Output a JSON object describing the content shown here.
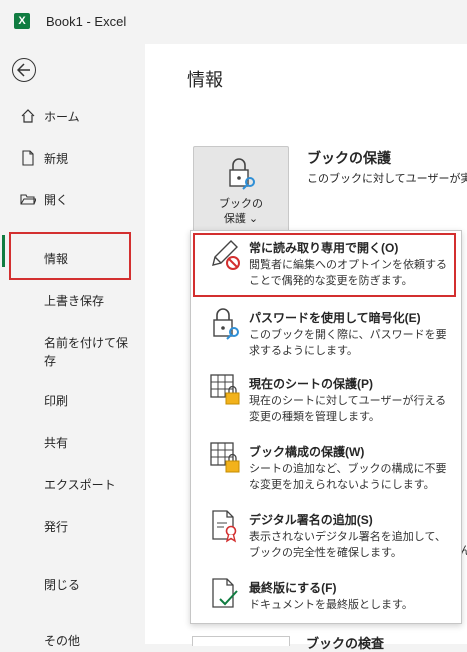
{
  "window": {
    "app_icon": "X",
    "title": "Book1  -  Excel"
  },
  "nav": {
    "back_icon": "back-arrow-icon",
    "items": [
      {
        "label": "ホーム",
        "icon": "home-icon"
      },
      {
        "label": "新規",
        "icon": "new-document-icon"
      },
      {
        "label": "開く",
        "icon": "open-folder-icon"
      },
      {
        "label": "情報"
      },
      {
        "label": "上書き保存"
      },
      {
        "label": "名前を付けて保存"
      },
      {
        "label": "印刷"
      },
      {
        "label": "共有"
      },
      {
        "label": "エクスポート"
      },
      {
        "label": "発行"
      },
      {
        "label": "閉じる"
      },
      {
        "label": "その他"
      }
    ],
    "active": "情報"
  },
  "main": {
    "title": "情報",
    "protect_button": {
      "line1": "ブックの",
      "line2": "保護 ⌄"
    },
    "section_title": "ブックの保護",
    "section_desc": "このブックに対してユーザーが実行",
    "peek_right": [
      "ん"
    ],
    "bottom_text": "ブックの検査"
  },
  "protect_menu": {
    "items": [
      {
        "title": "常に読み取り専用で開く(O)",
        "desc": "閲覧者に編集へのオプトインを依頼することで偶発的な変更を防ぎます。",
        "icon": "pencil-no-icon"
      },
      {
        "title": "パスワードを使用して暗号化(E)",
        "desc": "このブックを開く際に、パスワードを要求するようにします。",
        "icon": "lock-key-icon"
      },
      {
        "title": "現在のシートの保護(P)",
        "desc": "現在のシートに対してユーザーが行える変更の種類を管理します。",
        "icon": "sheet-lock-icon"
      },
      {
        "title": "ブック構成の保護(W)",
        "desc": "シートの追加など、ブックの構成に不要な変更を加えられないようにします。",
        "icon": "workbook-lock-icon"
      },
      {
        "title": "デジタル署名の追加(S)",
        "desc": "表示されないデジタル署名を追加して、ブックの完全性を確保します。",
        "icon": "signature-ribbon-icon"
      },
      {
        "title": "最終版にする(F)",
        "desc": "ドキュメントを最終版とします。",
        "icon": "final-document-icon"
      }
    ]
  },
  "colors": {
    "accent": "#107c41",
    "highlight": "#d32f2f",
    "icon_lock": "#f2b21b",
    "icon_key": "#2f8fd6"
  }
}
